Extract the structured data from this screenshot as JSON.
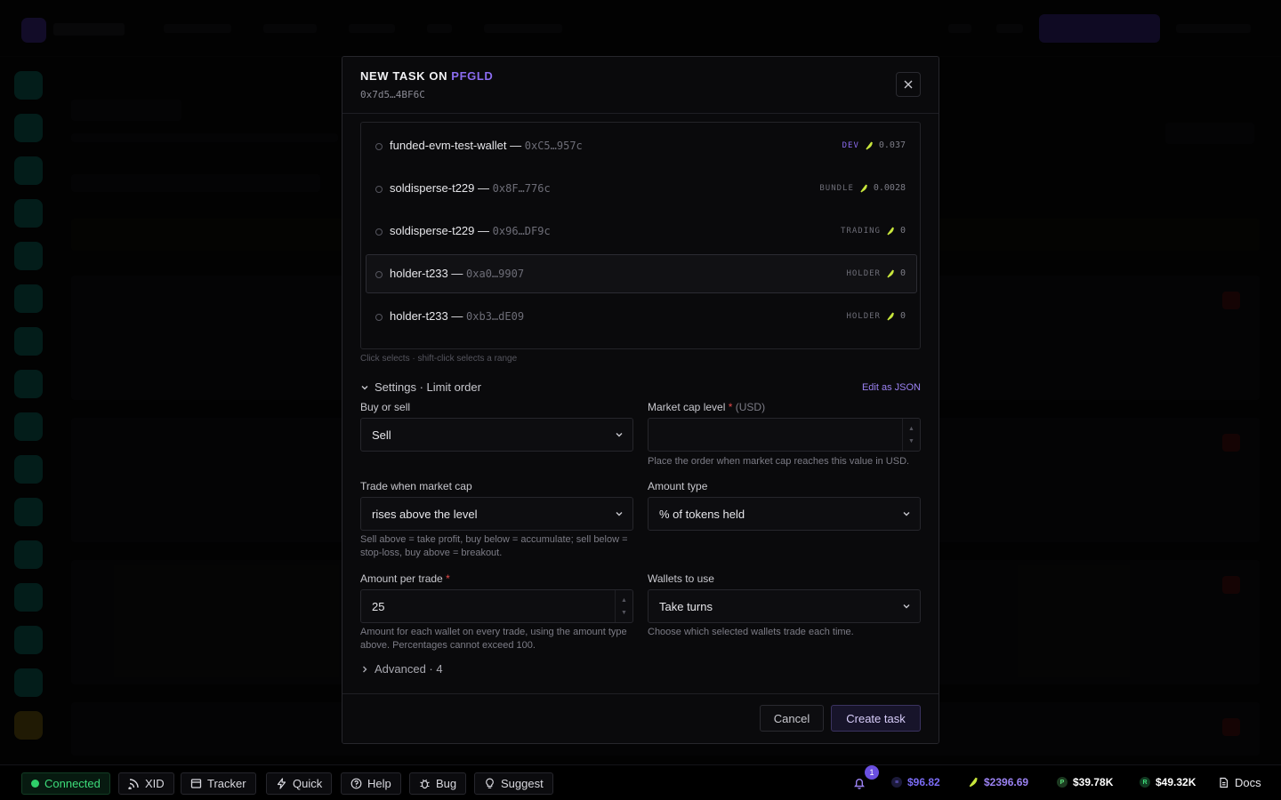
{
  "modal": {
    "title_prefix": "NEW TASK ON",
    "token": "PFGLD",
    "contract": "0x7d5…4BF6C"
  },
  "wallets": [
    {
      "name": "funded-evm-test-wallet",
      "sep": "—",
      "address": "0xC5…957c",
      "tag": "DEV",
      "balance": "0.037"
    },
    {
      "name": "soldisperse-t229",
      "sep": "—",
      "address": "0x8F…776c",
      "tag": "BUNDLE",
      "balance": "0.0028"
    },
    {
      "name": "soldisperse-t229",
      "sep": "—",
      "address": "0x96…DF9c",
      "tag": "TRADING",
      "balance": "0"
    },
    {
      "name": "holder-t233",
      "sep": "—",
      "address": "0xa0…9907",
      "tag": "HOLDER",
      "balance": "0"
    },
    {
      "name": "holder-t233",
      "sep": "—",
      "address": "0xb3…dE09",
      "tag": "HOLDER",
      "balance": "0"
    }
  ],
  "wallet_hint": "Click selects · shift-click selects a range",
  "settings": {
    "header": "Settings · Limit order",
    "edit_json": "Edit as JSON",
    "buy_or_sell": {
      "label": "Buy or sell",
      "value": "Sell"
    },
    "market_cap": {
      "label": "Market cap level",
      "required": "*",
      "unit": "(USD)",
      "value": "",
      "help": "Place the order when market cap reaches this value in USD."
    },
    "trade_when": {
      "label": "Trade when market cap",
      "value": "rises above the level",
      "help": "Sell above = take profit, buy below = accumulate; sell below = stop-loss, buy above = breakout."
    },
    "amount_type": {
      "label": "Amount type",
      "value": "% of tokens held"
    },
    "amount_per_trade": {
      "label": "Amount per trade",
      "required": "*",
      "value": "25",
      "help": "Amount for each wallet on every trade, using the amount type above. Percentages cannot exceed 100."
    },
    "wallets_to_use": {
      "label": "Wallets to use",
      "value": "Take turns",
      "help": "Choose which selected wallets trade each time."
    },
    "advanced": "Advanced · 4"
  },
  "footer": {
    "cancel": "Cancel",
    "create": "Create task"
  },
  "statusbar": {
    "connected": "Connected",
    "chips": [
      "XID",
      "Tracker",
      "Quick",
      "Help",
      "Bug",
      "Suggest"
    ],
    "notifications": "1",
    "prices": [
      {
        "symbol": "≡",
        "value": "$96.82",
        "color": "#7b6cf6"
      },
      {
        "symbol": "⬧",
        "value": "$2396.69",
        "color": "#9b82f2"
      },
      {
        "symbol": "P",
        "value": "$39.78K",
        "color": "#ffffff"
      },
      {
        "symbol": "R",
        "value": "$49.32K",
        "color": "#ffffff"
      }
    ],
    "docs": "Docs"
  },
  "colors": {
    "accent": "#8b6cf0",
    "connected": "#3ddc7a",
    "required": "#e04a4a",
    "feather": "#c8e63c"
  }
}
